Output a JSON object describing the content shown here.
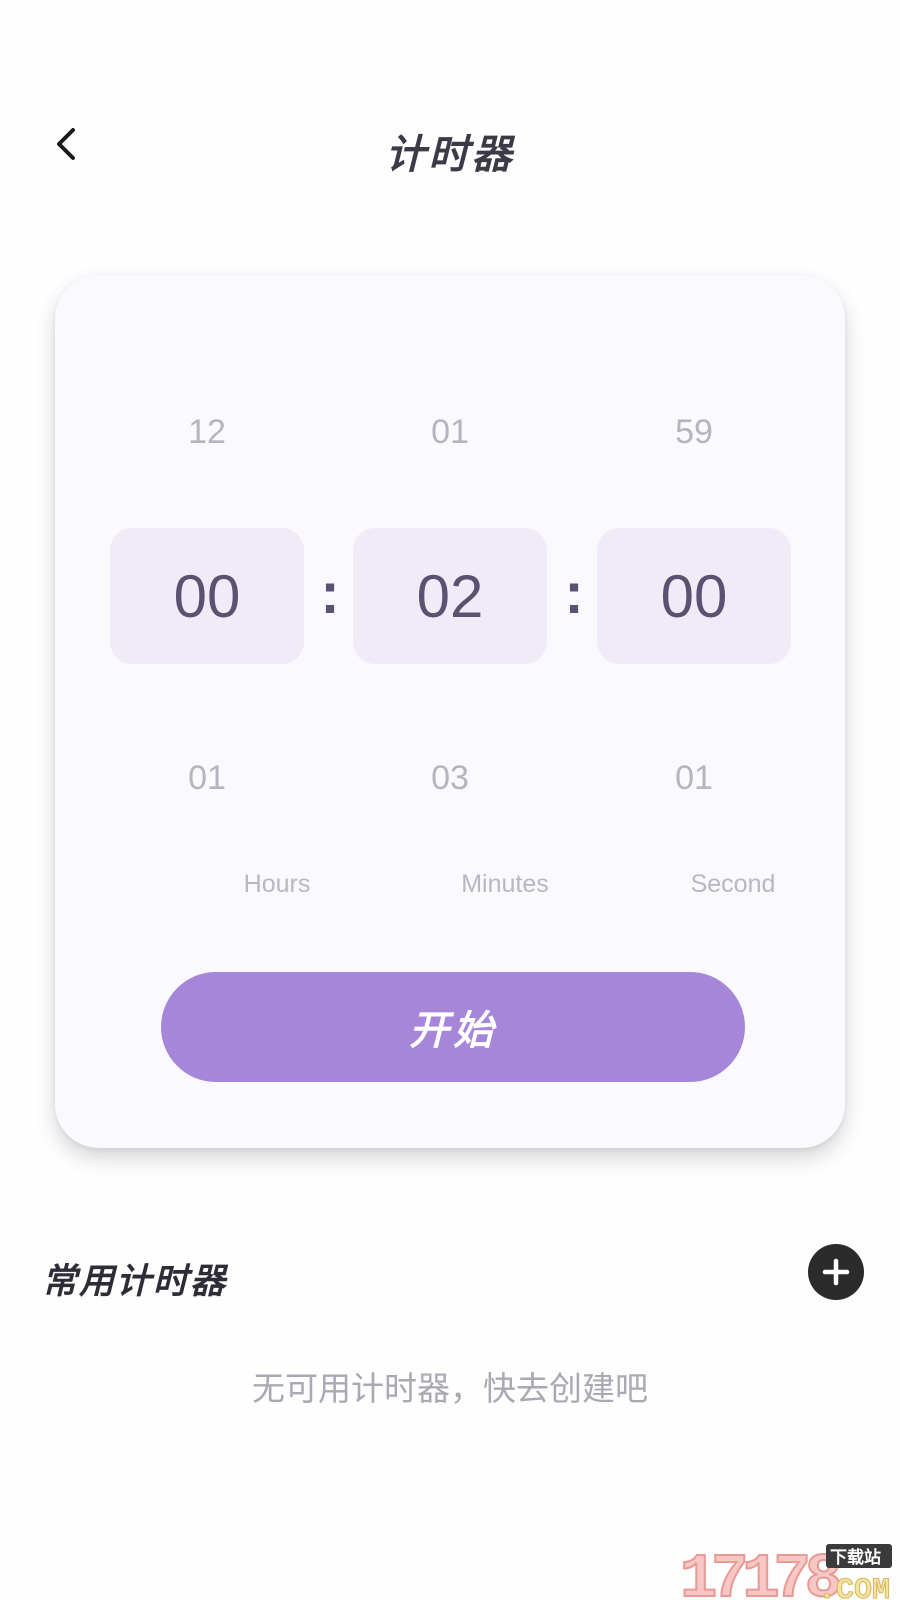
{
  "header": {
    "title": "计时器"
  },
  "picker": {
    "hours": {
      "prev": "12",
      "current": "00",
      "next": "01",
      "label": "Hours"
    },
    "minutes": {
      "prev": "01",
      "current": "02",
      "next": "03",
      "label": "Minutes"
    },
    "seconds": {
      "prev": "59",
      "current": "00",
      "next": "01",
      "label": "Second"
    },
    "separator": ":"
  },
  "start_button": {
    "label": "开始"
  },
  "common_timers": {
    "title": "常用计时器",
    "empty_text": "无可用计时器，快去创建吧"
  },
  "watermark": {
    "text": "17178",
    "badge": "下载站",
    "suffix": ".COM"
  },
  "colors": {
    "accent": "#a686d9",
    "picker_bg": "#f1ebf7",
    "card_bg": "#faf9fd",
    "digit": "#5a5270"
  },
  "icons": {
    "back": "chevron-left-icon",
    "add": "plus-circle-icon"
  }
}
